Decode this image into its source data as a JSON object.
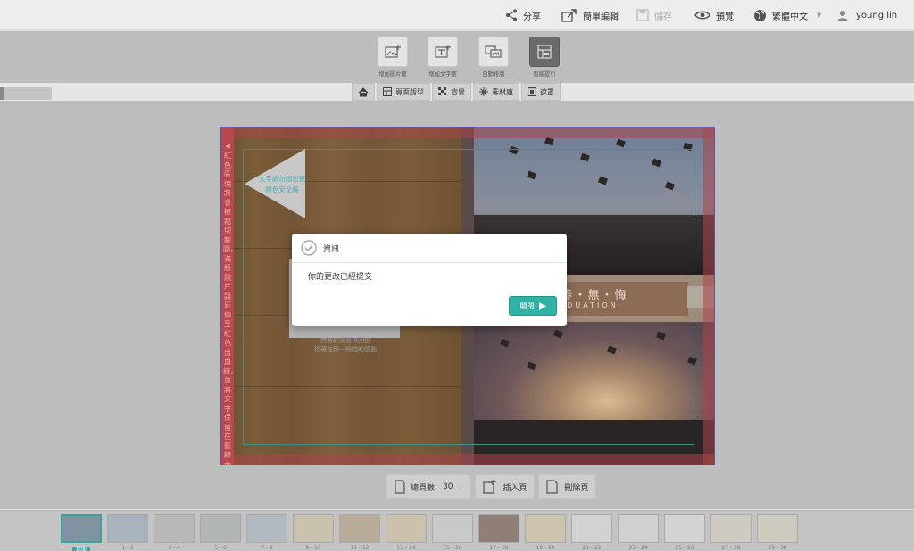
{
  "header": {
    "share": "分享",
    "simple_edit": "簡單編輯",
    "save": "儲存",
    "preview": "預覽",
    "language": "繁體中文",
    "user": "young lin"
  },
  "toolbar": {
    "add_image_box": "增加圖片框",
    "add_text_box": "增加文字框",
    "auto_fill": "自動排版",
    "smart_guide": "智能提引"
  },
  "subtabs": [
    "頁面版型",
    "背景",
    "素材庫",
    "遮罩"
  ],
  "canvas": {
    "bleed_notice": "紅色區塊將會被裁切範圍，滿版照片請延伸至紅色出血線，並將文字保留在藍線內",
    "text_tip": "文字請勿超出藍線色安全線",
    "caption_line1": "無數的青春與回憶",
    "caption_line2": "珍藏在那一瞬間的感動",
    "banner_title": "青‧春‧無‧悔",
    "banner_subtitle": "GRADUATION"
  },
  "pagebar": {
    "total_pages_label": "總頁數:",
    "total_pages_value": "30",
    "insert_page": "插入頁",
    "delete_page": "刪除頁"
  },
  "thumbnails": [
    {
      "label": "封面",
      "selected": true
    },
    {
      "label": "1 - 2"
    },
    {
      "label": "3 - 4"
    },
    {
      "label": "5 - 6"
    },
    {
      "label": "7 - 8"
    },
    {
      "label": "9 - 10"
    },
    {
      "label": "11 - 12"
    },
    {
      "label": "13 - 14"
    },
    {
      "label": "15 - 16"
    },
    {
      "label": "17 - 18"
    },
    {
      "label": "19 - 20"
    },
    {
      "label": "21 - 22"
    },
    {
      "label": "23 - 24"
    },
    {
      "label": "25 - 26"
    },
    {
      "label": "27 - 28"
    },
    {
      "label": "29 - 30"
    }
  ],
  "modal": {
    "title": "資訊",
    "message": "你的更改已經提交",
    "close": "關閉"
  },
  "colors": {
    "accent": "#31b2a6",
    "bleed": "#b8484d",
    "safe_line": "#3f8e87"
  }
}
